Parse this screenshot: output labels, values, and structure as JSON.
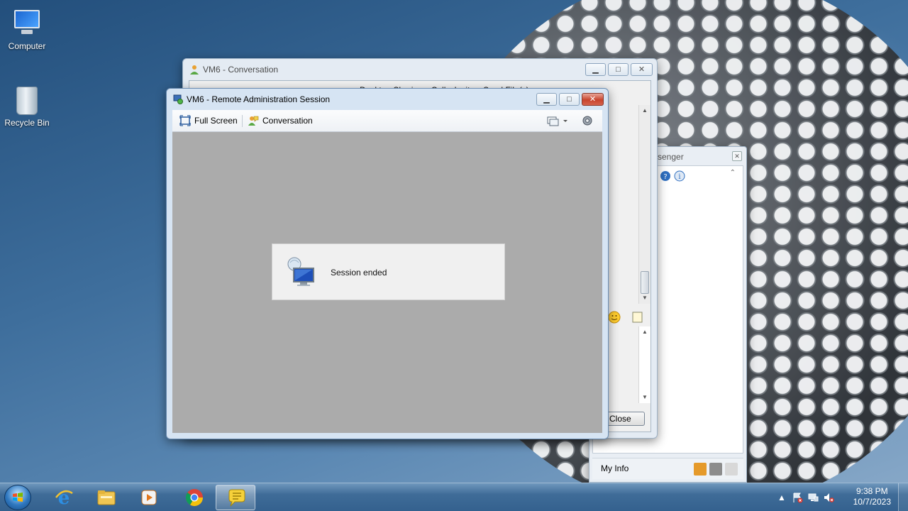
{
  "desktop": {
    "icons": [
      {
        "label": "Computer"
      },
      {
        "label": "Recycle Bin"
      }
    ]
  },
  "conversation_window": {
    "title": "VM6 - Conversation",
    "toolbar_items": [
      "Desktop Sharing",
      "Call",
      "Invite",
      "Send File(s)"
    ],
    "close_label": "Close"
  },
  "messenger_window": {
    "title_fragment": "senger",
    "my_info": "My Info"
  },
  "session_window": {
    "title": "VM6 - Remote Administration Session",
    "full_screen_label": "Full Screen",
    "conversation_label": "Conversation",
    "status_message": "Session ended"
  },
  "taskbar": {
    "apps": [
      "Internet Explorer",
      "Windows Explorer",
      "Windows Media Player",
      "Google Chrome",
      "Windows Live Messenger"
    ],
    "clock_time": "9:38 PM",
    "clock_date": "10/7/2023"
  },
  "colors": {
    "title_active": "#d6e4f3",
    "viewport_gray": "#ababab",
    "close_red": "#c8442d",
    "taskbar_blue": "#3f6c98"
  }
}
